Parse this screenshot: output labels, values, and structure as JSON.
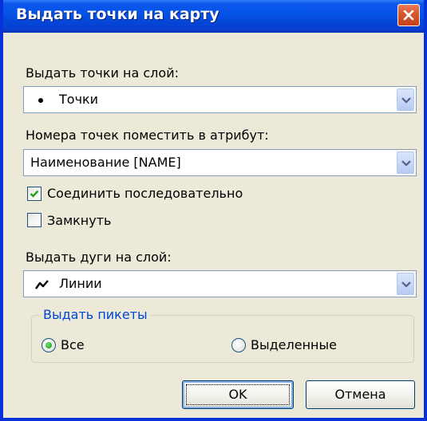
{
  "window": {
    "title": "Выдать точки на карту"
  },
  "layer_section": {
    "label": "Выдать точки на слой:",
    "selected": "Точки",
    "icon": "point-bullet-icon"
  },
  "attribute_section": {
    "label": "Номера точек поместить в атрибут:",
    "selected": "Наименование [NAME]"
  },
  "options": {
    "connect_label": "Соединить последовательно",
    "connect_checked": true,
    "close_label": "Замкнуть",
    "close_checked": false
  },
  "arcs_section": {
    "label": "Выдать дуги на слой:",
    "selected": "Линии",
    "icon": "polyline-icon"
  },
  "pickets_group": {
    "title": "Выдать пикеты",
    "options": [
      {
        "label": "Все",
        "selected": true
      },
      {
        "label": "Выделенные",
        "selected": false
      }
    ]
  },
  "buttons": {
    "ok": "OK",
    "cancel": "Отмена"
  },
  "colors": {
    "title_bar": "#0552e6",
    "frame_border": "#0831d9",
    "dialog_bg": "#ece9d8",
    "group_title": "#0046d5",
    "close_button": "#d9542b"
  }
}
